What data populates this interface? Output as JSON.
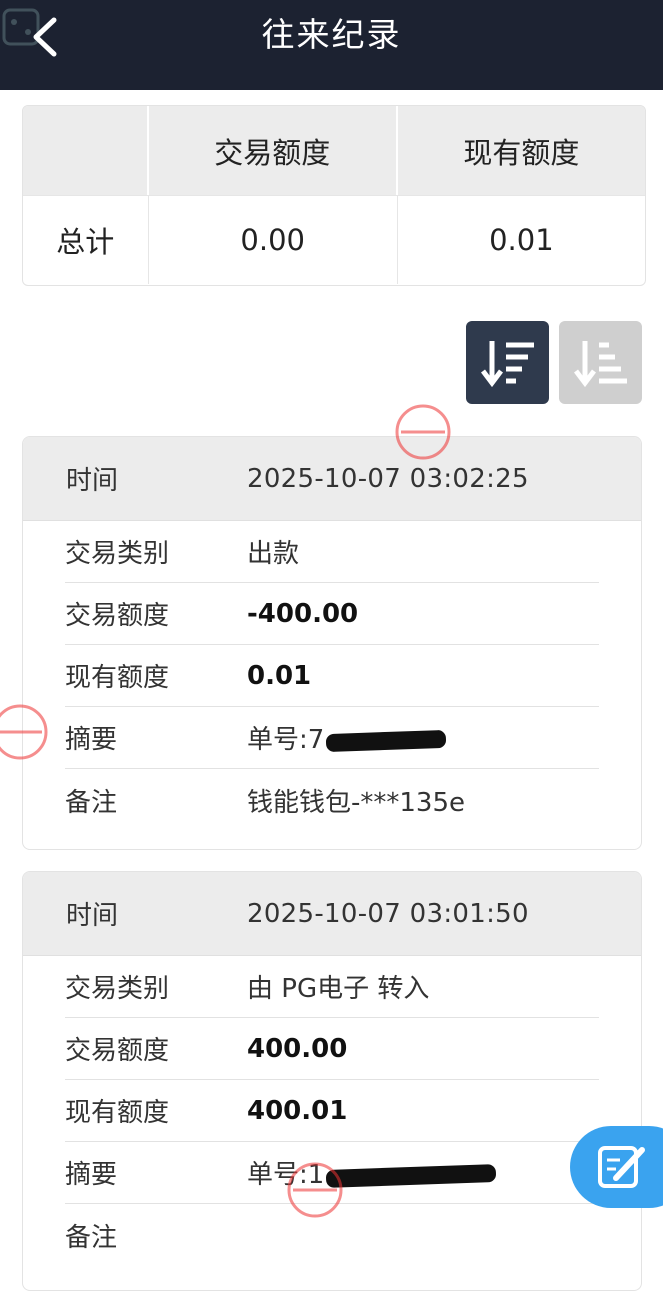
{
  "header": {
    "title": "往来纪录"
  },
  "summary": {
    "headers": [
      "",
      "交易额度",
      "现有额度"
    ],
    "row": {
      "label": "总计",
      "trade_amount": "0.00",
      "current_amount": "0.01"
    }
  },
  "sort": {
    "active": "desc"
  },
  "records": [
    {
      "time_label": "时间",
      "time": "2025-10-07 03:02:25",
      "rows": [
        {
          "label": "交易类别",
          "value": "出款",
          "bold": false
        },
        {
          "label": "交易额度",
          "value": "-400.00",
          "bold": true
        },
        {
          "label": "现有额度",
          "value": "0.01",
          "bold": true
        },
        {
          "label": "摘要",
          "value": "单号:7",
          "bold": false,
          "redacted": true
        },
        {
          "label": "备注",
          "value": "钱能钱包-***135e",
          "bold": false
        }
      ]
    },
    {
      "time_label": "时间",
      "time": "2025-10-07 03:01:50",
      "rows": [
        {
          "label": "交易类别",
          "value": "由 PG电子 转入",
          "bold": false
        },
        {
          "label": "交易额度",
          "value": "400.00",
          "bold": true
        },
        {
          "label": "现有额度",
          "value": "400.01",
          "bold": true
        },
        {
          "label": "摘要",
          "value": "单号:1",
          "bold": false,
          "redacted": true
        },
        {
          "label": "备注",
          "value": "",
          "bold": false
        }
      ]
    }
  ],
  "colors": {
    "header_bg": "#1c2231",
    "sort_active": "#2f3a4d",
    "sort_inactive": "#cfcfcf",
    "fab": "#3aa3ef"
  },
  "icons": {
    "back": "chevron-left-icon",
    "sort_desc": "sort-desc-icon",
    "sort_asc": "sort-asc-icon",
    "fab": "edit-icon"
  }
}
